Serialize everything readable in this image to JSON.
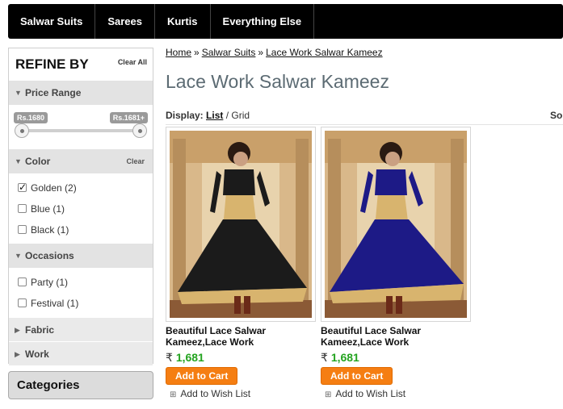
{
  "nav": {
    "items": [
      "Salwar Suits",
      "Sarees",
      "Kurtis",
      "Everything Else"
    ]
  },
  "refine": {
    "title": "REFINE BY",
    "clear_all": "Clear All",
    "price": {
      "label": "Price Range",
      "min": "Rs.1680",
      "max": "Rs.1681+"
    },
    "color": {
      "label": "Color",
      "clear": "Clear",
      "options": [
        {
          "label": "Golden (2)",
          "checked": true
        },
        {
          "label": "Blue (1)",
          "checked": false
        },
        {
          "label": "Black (1)",
          "checked": false
        }
      ]
    },
    "occasions": {
      "label": "Occasions",
      "options": [
        {
          "label": "Party (1)",
          "checked": false
        },
        {
          "label": "Festival (1)",
          "checked": false
        }
      ]
    },
    "fabric": {
      "label": "Fabric"
    },
    "work": {
      "label": "Work"
    }
  },
  "categories": {
    "label": "Categories"
  },
  "breadcrumb": [
    "Home",
    "Salwar Suits",
    "Lace Work Salwar Kameez"
  ],
  "breadcrumb_sep": "»",
  "page": {
    "title": "Lace Work Salwar Kameez",
    "display_label": "Display:",
    "list": "List",
    "grid": "Grid",
    "sort_label": "So"
  },
  "products": [
    {
      "name_line1": "Beautiful Lace Salwar",
      "name_line2": "Kameez,Lace Work",
      "currency": "₹",
      "price": "1,681",
      "cart_label": "Add to Cart",
      "wish_label": "Add to Wish List",
      "dress_color": "#1b1b1b"
    },
    {
      "name_line1": "Beautiful Lace Salwar",
      "name_line2": "Kameez,Lace Work",
      "currency": "₹",
      "price": "1,681",
      "cart_label": "Add to Cart",
      "wish_label": "Add to Wish List",
      "dress_color": "#1d1a86"
    }
  ]
}
